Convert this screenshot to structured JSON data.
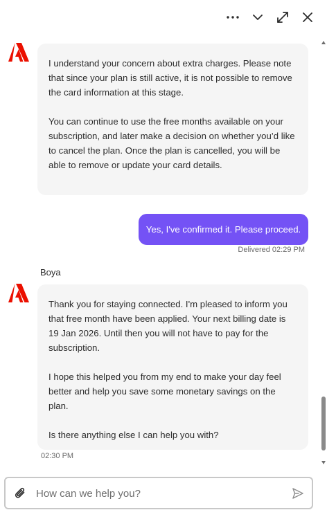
{
  "header": {
    "more_icon": "more-horizontal-icon",
    "collapse_icon": "chevron-down-icon",
    "expand_icon": "expand-arrows-icon",
    "close_icon": "close-icon"
  },
  "conversation": {
    "message1": {
      "sender_logo": "adobe-logo-icon",
      "paragraph1": "I understand your concern about extra charges. Please note that since your plan is still active, it is not possible to remove the card information at this stage.",
      "paragraph2": "You can continue to use the free months available on your subscription, and later make a decision on whether you’d like to cancel the plan. Once the plan is cancelled, you will be able to remove or update your card details."
    },
    "user_message": {
      "text": "Yes, I've confirmed it. Please proceed.",
      "status": "Delivered 02:29 PM"
    },
    "agent_name": "Boya",
    "message2": {
      "sender_logo": "adobe-logo-icon",
      "paragraph1": "Thank you for staying connected. I'm pleased to inform you that free month have been applied. Your next billing date is 19 Jan 2026. Until then you will not have to pay for the subscription.",
      "paragraph2": "I hope this helped you from my end to make your day feel better and help you save some monetary savings on the plan.",
      "paragraph3": "Is there anything else I can help you with?",
      "time": "02:30 PM"
    }
  },
  "composer": {
    "placeholder": "How can we help you?",
    "value": "",
    "attach_icon": "paperclip-icon",
    "send_icon": "send-icon"
  },
  "colors": {
    "brand_red": "#eb1000",
    "user_bubble": "#7452f5",
    "agent_bubble": "#f5f5f5"
  }
}
